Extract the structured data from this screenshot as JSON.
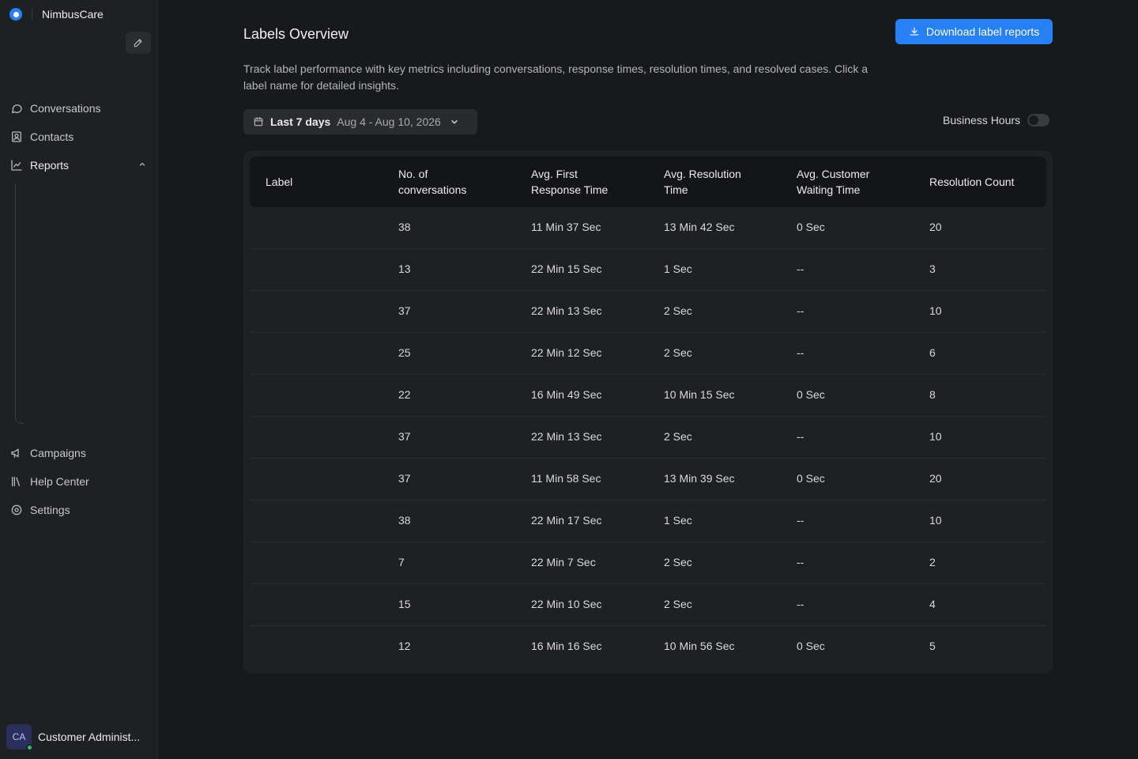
{
  "sidebar": {
    "brand_name": "NimbusCare",
    "items": [
      {
        "label": "Conversations"
      },
      {
        "label": "Contacts"
      },
      {
        "label": "Reports"
      },
      {
        "label": "Campaigns"
      },
      {
        "label": "Help Center"
      },
      {
        "label": "Settings"
      }
    ],
    "user": {
      "initials": "CA",
      "name": "Customer Administ..."
    }
  },
  "header": {
    "title": "Labels Overview",
    "download_label": "Download label reports",
    "description": "Track label performance with key metrics including conversations, response times, resolution times, and resolved cases. Click a label name for detailed insights."
  },
  "filters": {
    "range_label": "Last 7 days",
    "range_dates": "Aug 4 - Aug 10, 2026",
    "business_hours_label": "Business Hours"
  },
  "table": {
    "columns": [
      "Label",
      "No. of conversations",
      "Avg. First Response Time",
      "Avg. Resolution Time",
      "Avg. Customer Waiting Time",
      "Resolution Count"
    ],
    "rows": [
      [
        "",
        "38",
        "11 Min 37 Sec",
        "13 Min 42 Sec",
        "0 Sec",
        "20"
      ],
      [
        "",
        "13",
        "22 Min 15 Sec",
        "1 Sec",
        "--",
        "3"
      ],
      [
        "",
        "37",
        "22 Min 13 Sec",
        "2 Sec",
        "--",
        "10"
      ],
      [
        "",
        "25",
        "22 Min 12 Sec",
        "2 Sec",
        "--",
        "6"
      ],
      [
        "",
        "22",
        "16 Min 49 Sec",
        "10 Min 15 Sec",
        "0 Sec",
        "8"
      ],
      [
        "",
        "37",
        "22 Min 13 Sec",
        "2 Sec",
        "--",
        "10"
      ],
      [
        "",
        "37",
        "11 Min 58 Sec",
        "13 Min 39 Sec",
        "0 Sec",
        "20"
      ],
      [
        "",
        "38",
        "22 Min 17 Sec",
        "1 Sec",
        "--",
        "10"
      ],
      [
        "",
        "7",
        "22 Min 7 Sec",
        "2 Sec",
        "--",
        "2"
      ],
      [
        "",
        "15",
        "22 Min 10 Sec",
        "2 Sec",
        "--",
        "4"
      ],
      [
        "",
        "12",
        "16 Min 16 Sec",
        "10 Min 56 Sec",
        "0 Sec",
        "5"
      ]
    ]
  },
  "colors": {
    "accent": "#2781f6",
    "background": "#18191b",
    "sidebar": "#1f2023"
  }
}
